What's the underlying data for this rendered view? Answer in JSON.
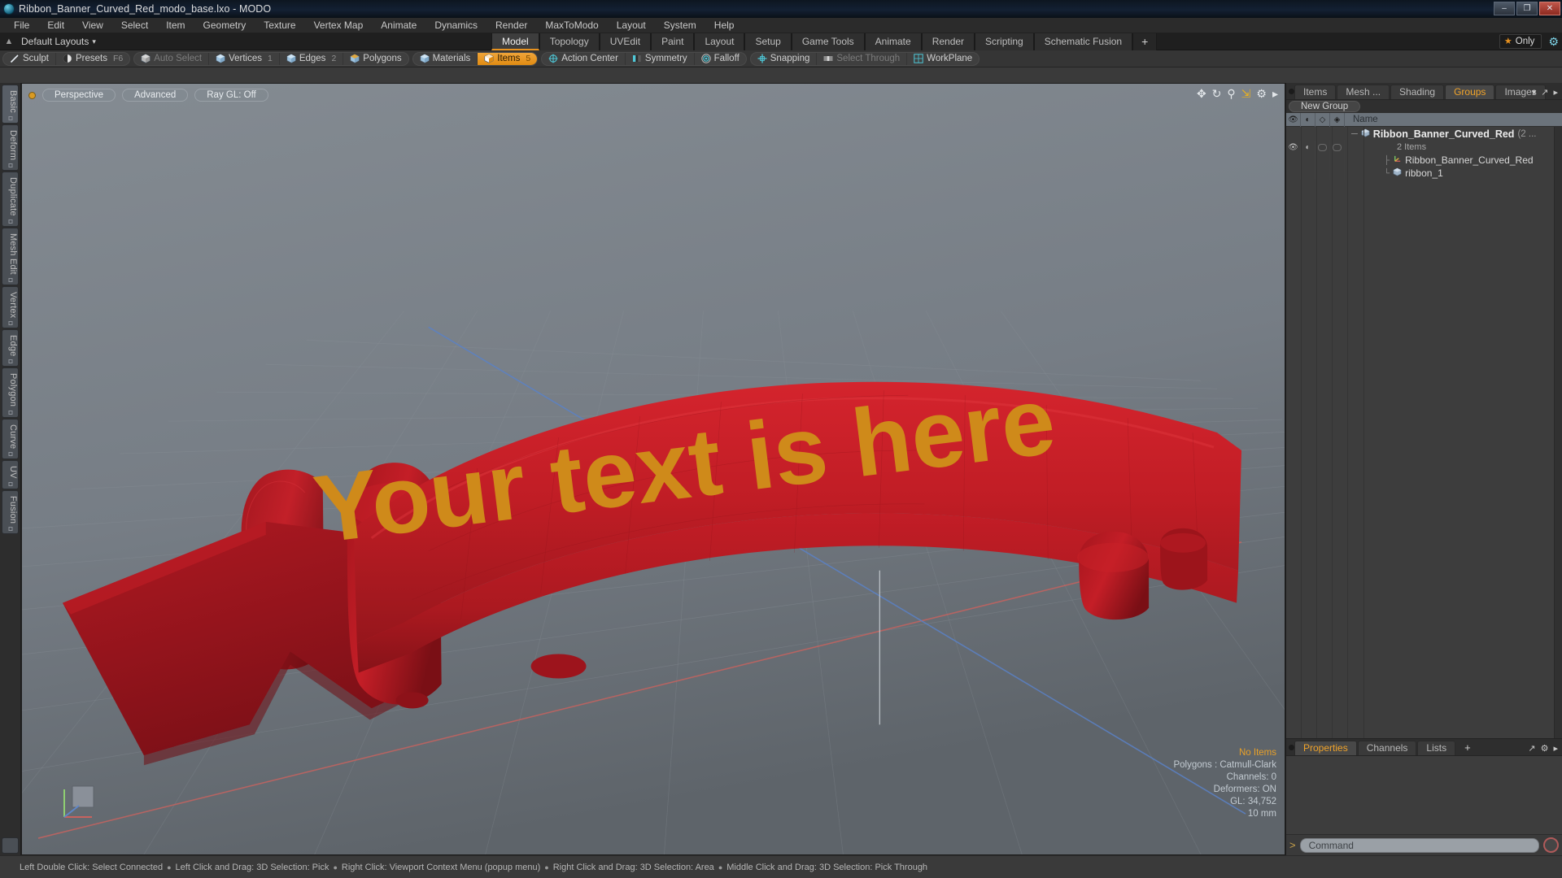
{
  "window": {
    "title": "Ribbon_Banner_Curved_Red_modo_base.lxo - MODO",
    "app_icon": "modo-logo-icon",
    "minimize": "–",
    "maximize": "❐",
    "close": "✕"
  },
  "menu": {
    "items": [
      "File",
      "Edit",
      "View",
      "Select",
      "Item",
      "Geometry",
      "Texture",
      "Vertex Map",
      "Animate",
      "Dynamics",
      "Render",
      "MaxToModo",
      "Layout",
      "System",
      "Help"
    ]
  },
  "layout_bar": {
    "home_icon": "home-icon",
    "label": "Default Layouts",
    "caret": "▾",
    "tabs": [
      {
        "label": "Model",
        "active": true
      },
      {
        "label": "Topology",
        "active": false
      },
      {
        "label": "UVEdit",
        "active": false
      },
      {
        "label": "Paint",
        "active": false
      },
      {
        "label": "Layout",
        "active": false
      },
      {
        "label": "Setup",
        "active": false
      },
      {
        "label": "Game Tools",
        "active": false
      },
      {
        "label": "Animate",
        "active": false
      },
      {
        "label": "Render",
        "active": false
      },
      {
        "label": "Scripting",
        "active": false
      },
      {
        "label": "Schematic Fusion",
        "active": false
      }
    ],
    "add_tab": "+",
    "only_label": "Only",
    "only_star": "★",
    "gear_icon": "gear-icon"
  },
  "mode_toolbar": {
    "groups": [
      {
        "items": [
          {
            "label": "Sculpt",
            "icon": "pen-icon",
            "shortcut": "",
            "state": "normal"
          },
          {
            "label": "Presets",
            "icon": "sphere-icon",
            "shortcut": "F6",
            "state": "normal"
          }
        ]
      },
      {
        "items": [
          {
            "label": "Auto Select",
            "icon": "cube-grey-icon",
            "shortcut": "",
            "state": "dim"
          },
          {
            "label": "Vertices",
            "icon": "cube-vertex-icon",
            "shortcut": "1",
            "state": "normal"
          },
          {
            "label": "Edges",
            "icon": "cube-edge-icon",
            "shortcut": "2",
            "state": "normal"
          },
          {
            "label": "Polygons",
            "icon": "cube-poly-icon",
            "shortcut": "",
            "state": "normal"
          }
        ]
      },
      {
        "items": [
          {
            "label": "Materials",
            "icon": "cube-material-icon",
            "shortcut": "",
            "state": "normal"
          },
          {
            "label": "Items",
            "icon": "cube-items-icon",
            "shortcut": "5",
            "state": "active"
          }
        ]
      },
      {
        "items": [
          {
            "label": "Action Center",
            "icon": "crosshair-circle-icon",
            "shortcut": "",
            "state": "normal"
          },
          {
            "label": "Symmetry",
            "icon": "symmetry-icon",
            "shortcut": "",
            "state": "normal"
          },
          {
            "label": "Falloff",
            "icon": "falloff-target-icon",
            "shortcut": "",
            "state": "normal"
          }
        ]
      },
      {
        "items": [
          {
            "label": "Snapping",
            "icon": "snapping-icon",
            "shortcut": "",
            "state": "normal"
          },
          {
            "label": "Select Through",
            "icon": "select-through-icon",
            "shortcut": "",
            "state": "dim"
          },
          {
            "label": "WorkPlane",
            "icon": "workplane-icon",
            "shortcut": "",
            "state": "normal"
          }
        ]
      }
    ]
  },
  "left_tabs": {
    "items": [
      "Basic",
      "Deform",
      "Duplicate",
      "Mesh Edit",
      "Vertex",
      "Edge",
      "Polygon",
      "Curve",
      "UV",
      "Fusion"
    ]
  },
  "viewport": {
    "pills": [
      "Perspective",
      "Advanced",
      "Ray GL: Off"
    ],
    "corner_icons": [
      "move-icon",
      "rotate-icon",
      "zoom-icon",
      "fit-icon",
      "gear-icon",
      "chevron-right-icon"
    ],
    "stats": {
      "selection": "No Items",
      "polygons": "Polygons : Catmull-Clark",
      "channels": "Channels: 0",
      "deformers": "Deformers: ON",
      "gl": "GL: 34,752",
      "grid": "10 mm"
    },
    "ribbon_text": "Your text is here",
    "ribbon_color": "#b31b22",
    "ribbon_text_color": "#cf8a1a",
    "axis_colors": {
      "x": "#c8625e",
      "y": "#8fcf72",
      "z": "#5f86c9"
    }
  },
  "right_panel": {
    "tabs": [
      {
        "label": "Items",
        "active": false
      },
      {
        "label": "Mesh ...",
        "active": false
      },
      {
        "label": "Shading",
        "active": false
      },
      {
        "label": "Groups",
        "active": true
      },
      {
        "label": "Images",
        "active": false
      }
    ],
    "tab_extra_icons": [
      "chevron-down-icon",
      "expand-icon",
      "chevron-right-icon"
    ],
    "new_group_button": "New Group",
    "list_header": {
      "col_icons": [
        "eye-icon",
        "render-icon",
        "wireframe-icon",
        "shaded-icon"
      ],
      "name": "Name"
    },
    "tree": [
      {
        "level": 0,
        "name": "Ribbon_Banner_Curved_Red",
        "suffix": "(2 ...",
        "icon": "group-cube-icon",
        "bold": true
      },
      {
        "level": 1,
        "name": "2 Items",
        "icon": "",
        "bold": false,
        "meta": true
      },
      {
        "level": 1,
        "name": "Ribbon_Banner_Curved_Red",
        "icon": "locator-axis-icon",
        "bold": false
      },
      {
        "level": 1,
        "name": "ribbon_1",
        "icon": "mesh-cube-icon",
        "bold": false
      }
    ]
  },
  "properties_panel": {
    "tabs": [
      {
        "label": "Properties",
        "active": true
      },
      {
        "label": "Channels",
        "active": false
      },
      {
        "label": "Lists",
        "active": false
      }
    ],
    "add_tab": "+",
    "right_icons": [
      "expand-icon",
      "gear-icon",
      "chevron-right-icon"
    ]
  },
  "command_bar": {
    "prompt": ">",
    "placeholder": "Command",
    "record_icon": "record-circle-icon"
  },
  "status_bar": {
    "hints": [
      "Left Double Click: Select Connected",
      "Left Click and Drag: 3D Selection: Pick",
      "Right Click: Viewport Context Menu (popup menu)",
      "Right Click and Drag: 3D Selection: Area",
      "Middle Click and Drag: 3D Selection: Pick Through"
    ],
    "separator": "●"
  }
}
